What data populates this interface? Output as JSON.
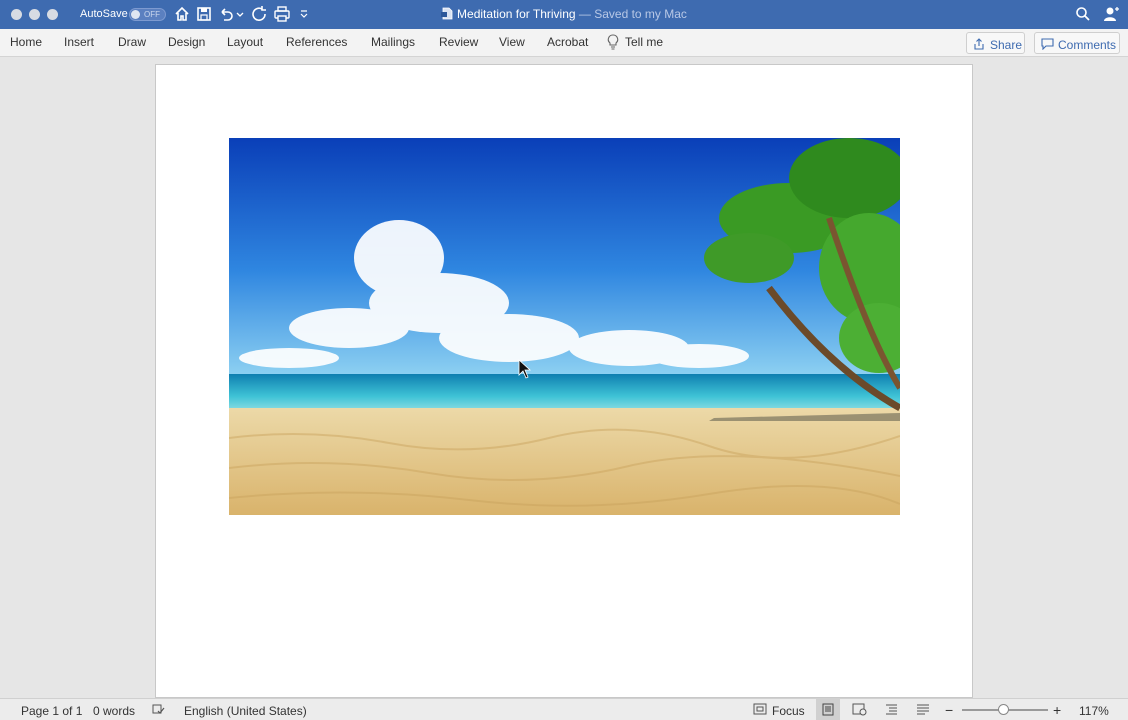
{
  "window": {
    "title": "Meditation for Thriving",
    "saved_status": "— Saved to my Mac",
    "autosave_label": "AutoSave",
    "autosave_state": "OFF"
  },
  "ribbon": {
    "tabs": [
      "Home",
      "Insert",
      "Draw",
      "Design",
      "Layout",
      "References",
      "Mailings",
      "Review",
      "View",
      "Acrobat"
    ],
    "tell_me": "Tell me",
    "share_label": "Share",
    "comments_label": "Comments"
  },
  "statusbar": {
    "page_info": "Page 1 of 1",
    "word_count": "0 words",
    "language": "English (United States)",
    "focus_label": "Focus",
    "zoom": "117%",
    "zoom_slider_level": 0.48
  },
  "document": {
    "image_subject": "tropical beach with palm trees"
  },
  "colors": {
    "title_bar": "#3e6bb0",
    "accent": "#3e6bb0"
  }
}
